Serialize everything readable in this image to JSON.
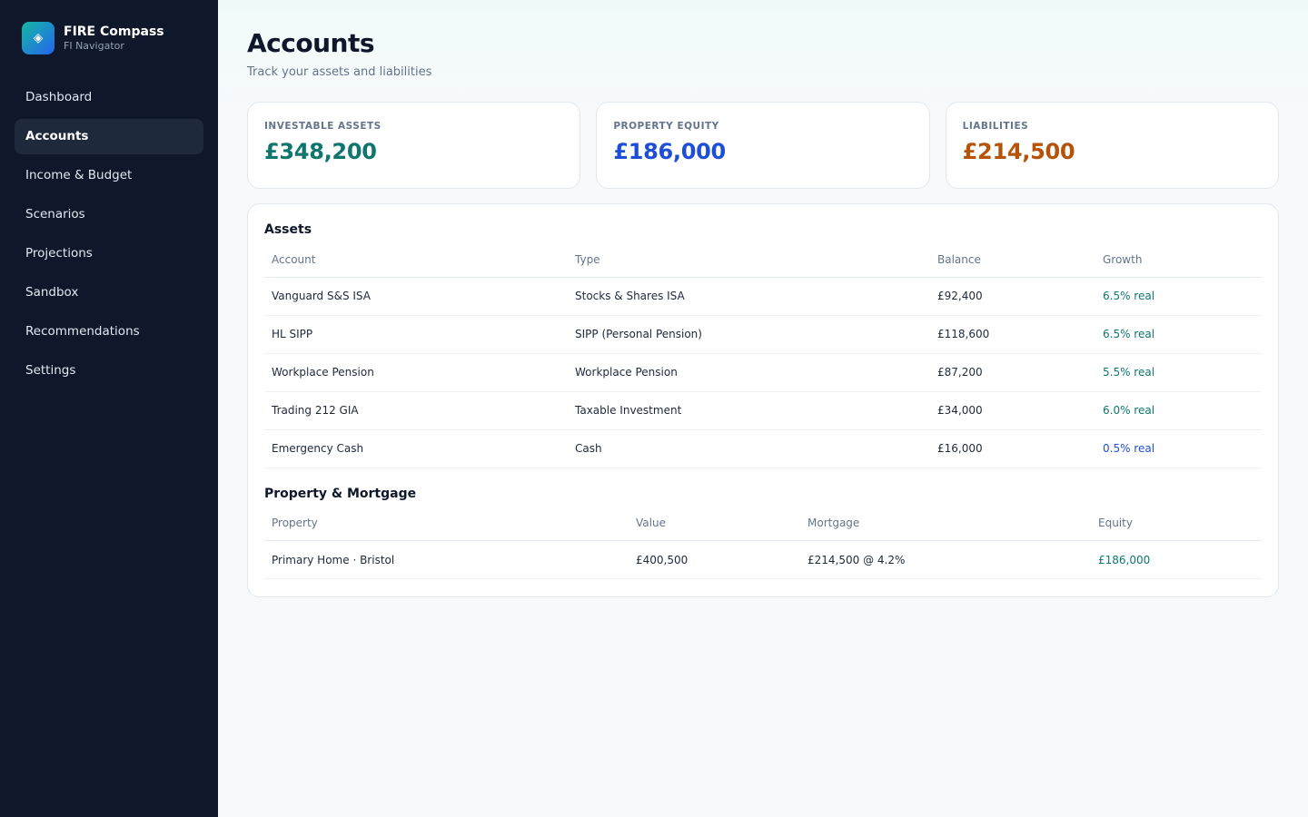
{
  "brand": {
    "title": "FIRE Compass",
    "subtitle": "FI Navigator",
    "logo_icon": "diamond-icon"
  },
  "nav": [
    {
      "label": "Dashboard",
      "active": false
    },
    {
      "label": "Accounts",
      "active": true
    },
    {
      "label": "Income & Budget",
      "active": false
    },
    {
      "label": "Scenarios",
      "active": false
    },
    {
      "label": "Projections",
      "active": false
    },
    {
      "label": "Sandbox",
      "active": false
    },
    {
      "label": "Recommendations",
      "active": false
    },
    {
      "label": "Settings",
      "active": false
    }
  ],
  "header": {
    "title": "Accounts",
    "subtitle": "Track your assets and liabilities"
  },
  "summary": [
    {
      "label": "INVESTABLE ASSETS",
      "value": "£348,200",
      "color": "#0f766e"
    },
    {
      "label": "PROPERTY EQUITY",
      "value": "£186,000",
      "color": "#1d4ed8"
    },
    {
      "label": "LIABILITIES",
      "value": "£214,500",
      "color": "#b45309"
    }
  ],
  "assets": {
    "title": "Assets",
    "columns": [
      "Account",
      "Type",
      "Balance",
      "Growth"
    ],
    "rows": [
      {
        "account": "Vanguard S&S ISA",
        "type": "Stocks & Shares ISA",
        "balance": "£92,400",
        "growth": "6.5% real",
        "growth_color": "#0f766e"
      },
      {
        "account": "HL SIPP",
        "type": "SIPP (Personal Pension)",
        "balance": "£118,600",
        "growth": "6.5% real",
        "growth_color": "#0f766e"
      },
      {
        "account": "Workplace Pension",
        "type": "Workplace Pension",
        "balance": "£87,200",
        "growth": "5.5% real",
        "growth_color": "#0f766e"
      },
      {
        "account": "Trading 212 GIA",
        "type": "Taxable Investment",
        "balance": "£34,000",
        "growth": "6.0% real",
        "growth_color": "#0f766e"
      },
      {
        "account": "Emergency Cash",
        "type": "Cash",
        "balance": "£16,000",
        "growth": "0.5% real",
        "growth_color": "#1d4ed8"
      }
    ]
  },
  "property": {
    "title": "Property & Mortgage",
    "columns": [
      "Property",
      "Value",
      "Mortgage",
      "Equity"
    ],
    "rows": [
      {
        "property": "Primary Home · Bristol",
        "value": "£400,500",
        "mortgage": "£214,500 @ 4.2%",
        "equity": "£186,000"
      }
    ]
  }
}
